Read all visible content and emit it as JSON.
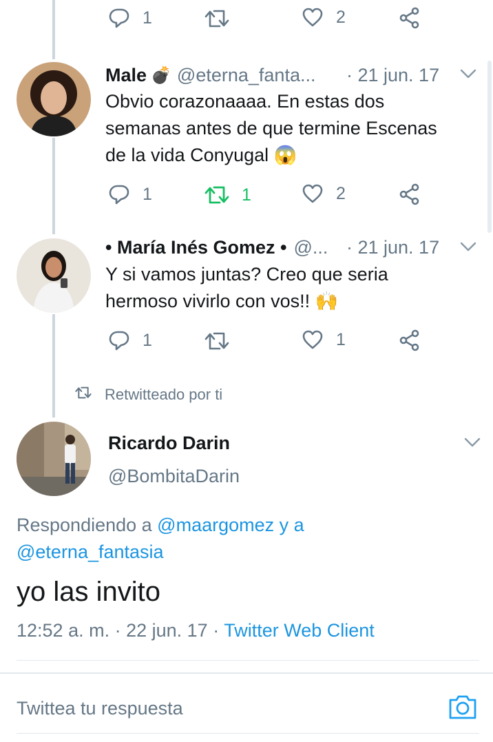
{
  "top_actions": {
    "reply_count": "1",
    "retweet_count": "",
    "like_count": "2"
  },
  "tweets": [
    {
      "name": "Male",
      "emoji_after_name": "💣",
      "handle": "@eterna_fanta...",
      "date": "· 21 jun. 17",
      "text_lines": [
        "Obvio corazonaaaa. En estas dos",
        "semanas antes de que termine Escenas",
        "de la vida Conyugal"
      ],
      "text_emoji": "😱",
      "reply_count": "1",
      "retweet_count": "1",
      "like_count": "2"
    },
    {
      "name": "• María Inés Gomez •",
      "handle": "@...",
      "date": "· 21 jun. 17",
      "text_lines": [
        "Y si vamos juntas? Creo que seria",
        "hermoso vivirlo con vos!!"
      ],
      "text_emoji": "🙌",
      "reply_count": "1",
      "retweet_count": "",
      "like_count": "1"
    }
  ],
  "retweeted_by": "Retwitteado por ti",
  "main_tweet": {
    "name": "Ricardo Darin",
    "handle": "@BombitaDarin",
    "replying_prefix": "Respondiendo a ",
    "replying_user1": "@maargomez",
    "replying_mid": " y a",
    "replying_user2": "@eterna_fantasia",
    "text": "yo las invito",
    "time": "12:52 a. m.",
    "date": "· 22 jun. 17 ·",
    "client": "Twitter Web Client"
  },
  "reply_box": {
    "placeholder": "Twittea tu respuesta"
  },
  "icons": {
    "reply": "reply-icon",
    "retweet": "retweet-icon",
    "like": "heart-icon",
    "share": "share-icon",
    "more": "chevron-down-icon",
    "camera": "camera-icon"
  },
  "colors": {
    "text": "#14171a",
    "secondary": "#657786",
    "link": "#1b95e0",
    "retweet_active": "#17bf63",
    "thread_line": "#ccd6dd",
    "divider": "#e1e8ed"
  }
}
